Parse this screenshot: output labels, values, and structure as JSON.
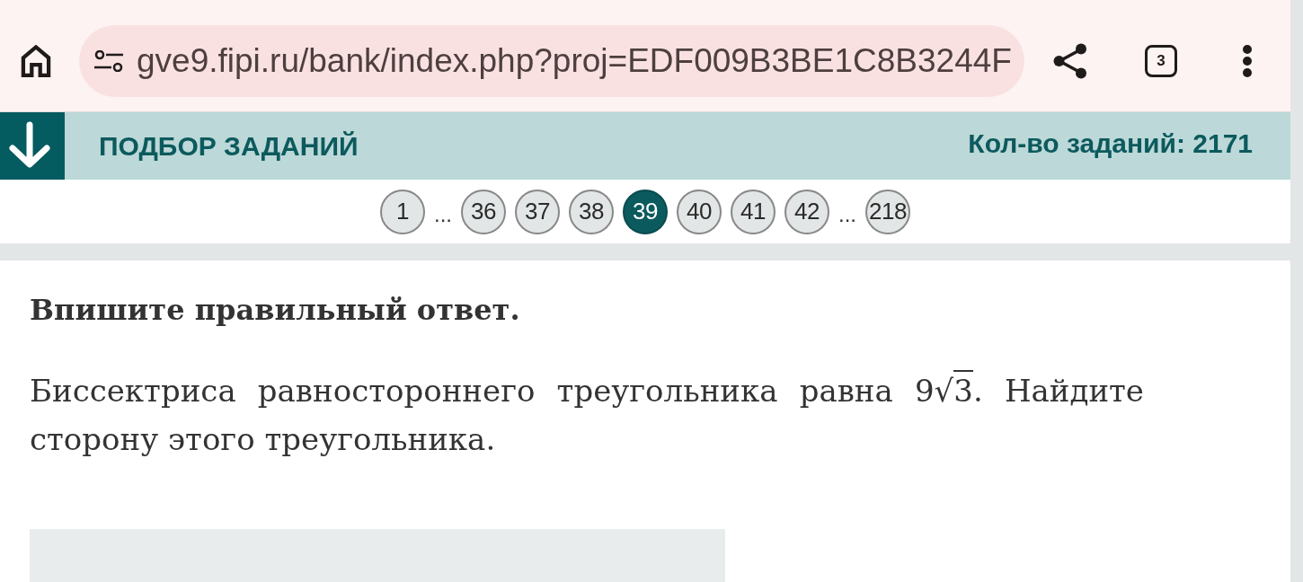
{
  "browser": {
    "url": "gve9.fipi.ru/bank/index.php?proj=EDF009B3BE1C8B3244F",
    "tab_count": "3"
  },
  "header": {
    "title": "ПОДБОР ЗАДАНИЙ",
    "count": "Кол-во заданий: 2171"
  },
  "pagination": [
    {
      "kind": "page",
      "label": "1",
      "selected": false
    },
    {
      "kind": "ellipsis",
      "label": "..."
    },
    {
      "kind": "page",
      "label": "36",
      "selected": false
    },
    {
      "kind": "page",
      "label": "37",
      "selected": false
    },
    {
      "kind": "page",
      "label": "38",
      "selected": false
    },
    {
      "kind": "page",
      "label": "39",
      "selected": true
    },
    {
      "kind": "page",
      "label": "40",
      "selected": false
    },
    {
      "kind": "page",
      "label": "41",
      "selected": false
    },
    {
      "kind": "page",
      "label": "42",
      "selected": false
    },
    {
      "kind": "ellipsis",
      "label": "..."
    },
    {
      "kind": "page",
      "label": "218",
      "selected": false
    }
  ],
  "task": {
    "instruction": "Впишите правильный ответ.",
    "question": [
      {
        "kind": "text",
        "text": "Биссектриса равностороннего треугольника равна "
      },
      {
        "kind": "sqrt",
        "coefficient": "9",
        "radical": "√",
        "radicand": "3"
      },
      {
        "kind": "text",
        "text": ". Найдите сторону этого треугольника."
      }
    ]
  }
}
